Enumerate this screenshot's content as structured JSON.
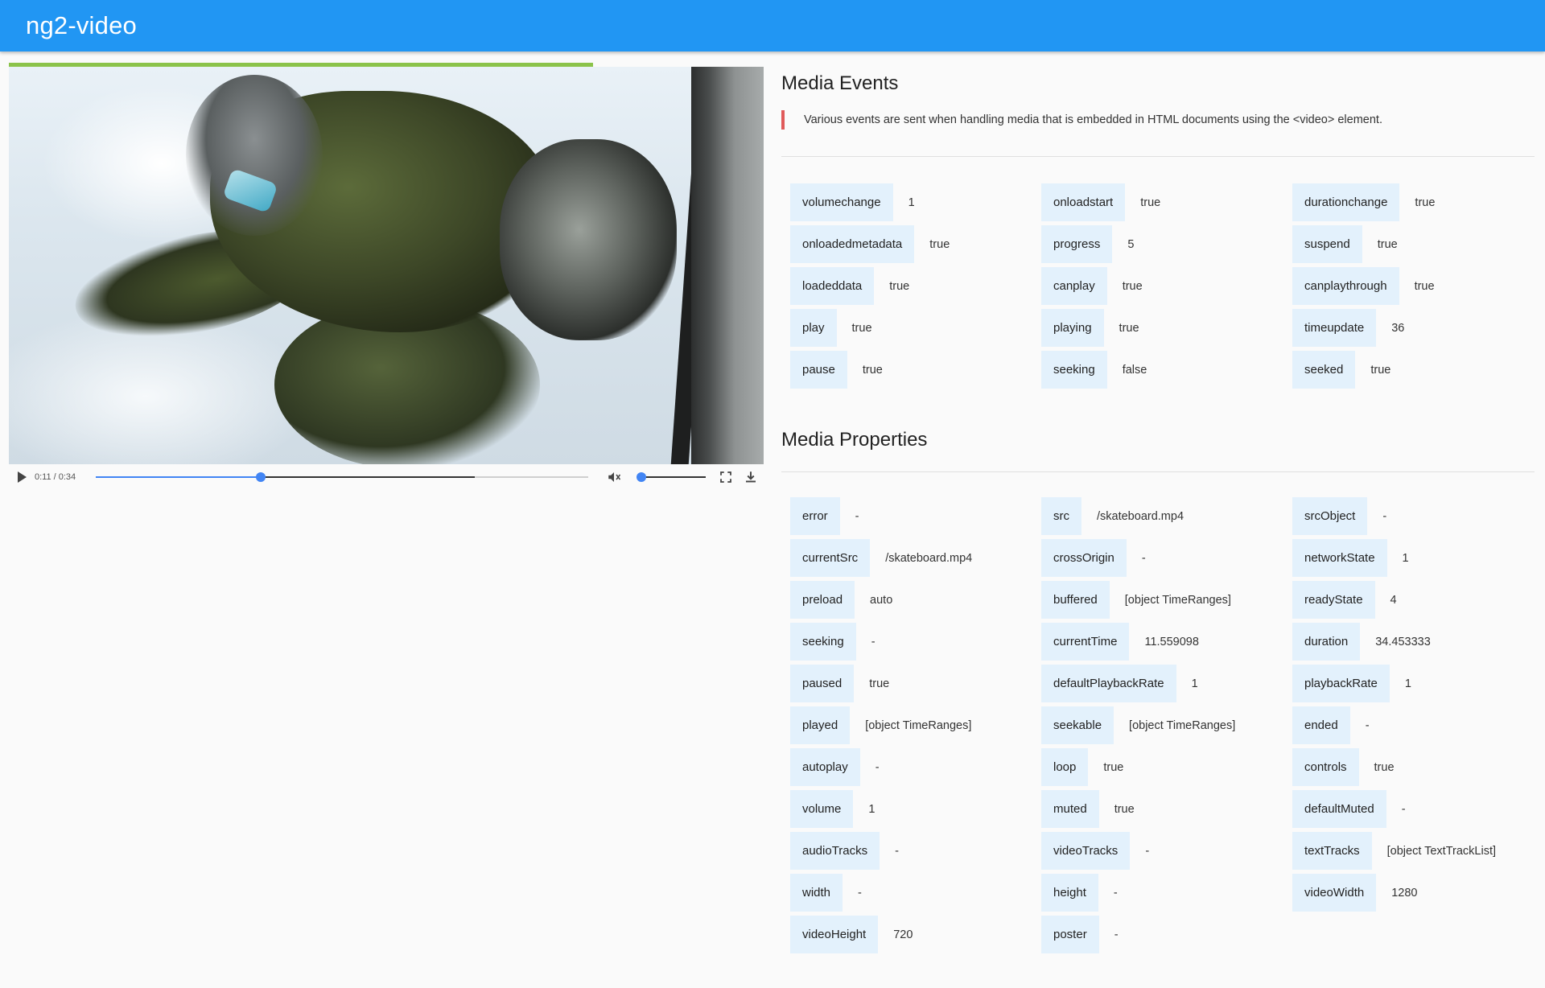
{
  "app": {
    "title": "ng2-video"
  },
  "player": {
    "time_display": "0:11 / 0:34",
    "current_time": 11.559098,
    "duration": 34.453333,
    "buffered_fraction": 0.77,
    "volume_level": 0,
    "muted": true,
    "accent_color": "#4285f4",
    "loaded_bar_color": "#8bc34a",
    "icons": {
      "play": "play-icon",
      "mute": "volume-off-icon",
      "fullscreen": "fullscreen-icon",
      "download": "download-icon"
    }
  },
  "events": {
    "title": "Media Events",
    "description": "Various events are sent when handling media that is embedded in HTML documents using the <video> element.",
    "columns": [
      [
        {
          "key": "volumechange",
          "value": "1"
        },
        {
          "key": "onloadedmetadata",
          "value": "true"
        },
        {
          "key": "loadeddata",
          "value": "true"
        },
        {
          "key": "play",
          "value": "true"
        },
        {
          "key": "pause",
          "value": "true"
        }
      ],
      [
        {
          "key": "onloadstart",
          "value": "true"
        },
        {
          "key": "progress",
          "value": "5"
        },
        {
          "key": "canplay",
          "value": "true"
        },
        {
          "key": "playing",
          "value": "true"
        },
        {
          "key": "seeking",
          "value": "false"
        }
      ],
      [
        {
          "key": "durationchange",
          "value": "true"
        },
        {
          "key": "suspend",
          "value": "true"
        },
        {
          "key": "canplaythrough",
          "value": "true"
        },
        {
          "key": "timeupdate",
          "value": "36"
        },
        {
          "key": "seeked",
          "value": "true"
        }
      ]
    ]
  },
  "properties": {
    "title": "Media Properties",
    "columns": [
      [
        {
          "key": "error",
          "value": "-"
        },
        {
          "key": "currentSrc",
          "value": "/skateboard.mp4"
        },
        {
          "key": "preload",
          "value": "auto"
        },
        {
          "key": "seeking",
          "value": "-"
        },
        {
          "key": "paused",
          "value": "true"
        },
        {
          "key": "played",
          "value": "[object TimeRanges]"
        },
        {
          "key": "autoplay",
          "value": "-"
        },
        {
          "key": "volume",
          "value": "1"
        },
        {
          "key": "audioTracks",
          "value": "-"
        },
        {
          "key": "width",
          "value": "-"
        },
        {
          "key": "videoHeight",
          "value": "720"
        }
      ],
      [
        {
          "key": "src",
          "value": "/skateboard.mp4"
        },
        {
          "key": "crossOrigin",
          "value": "-"
        },
        {
          "key": "buffered",
          "value": "[object TimeRanges]"
        },
        {
          "key": "currentTime",
          "value": "11.559098"
        },
        {
          "key": "defaultPlaybackRate",
          "value": "1"
        },
        {
          "key": "seekable",
          "value": "[object TimeRanges]"
        },
        {
          "key": "loop",
          "value": "true"
        },
        {
          "key": "muted",
          "value": "true"
        },
        {
          "key": "videoTracks",
          "value": "-"
        },
        {
          "key": "height",
          "value": "-"
        },
        {
          "key": "poster",
          "value": "-"
        }
      ],
      [
        {
          "key": "srcObject",
          "value": "-"
        },
        {
          "key": "networkState",
          "value": "1"
        },
        {
          "key": "readyState",
          "value": "4"
        },
        {
          "key": "duration",
          "value": "34.453333"
        },
        {
          "key": "playbackRate",
          "value": "1"
        },
        {
          "key": "ended",
          "value": "-"
        },
        {
          "key": "controls",
          "value": "true"
        },
        {
          "key": "defaultMuted",
          "value": "-"
        },
        {
          "key": "textTracks",
          "value": "[object TextTrackList]"
        },
        {
          "key": "videoWidth",
          "value": "1280"
        }
      ]
    ]
  }
}
